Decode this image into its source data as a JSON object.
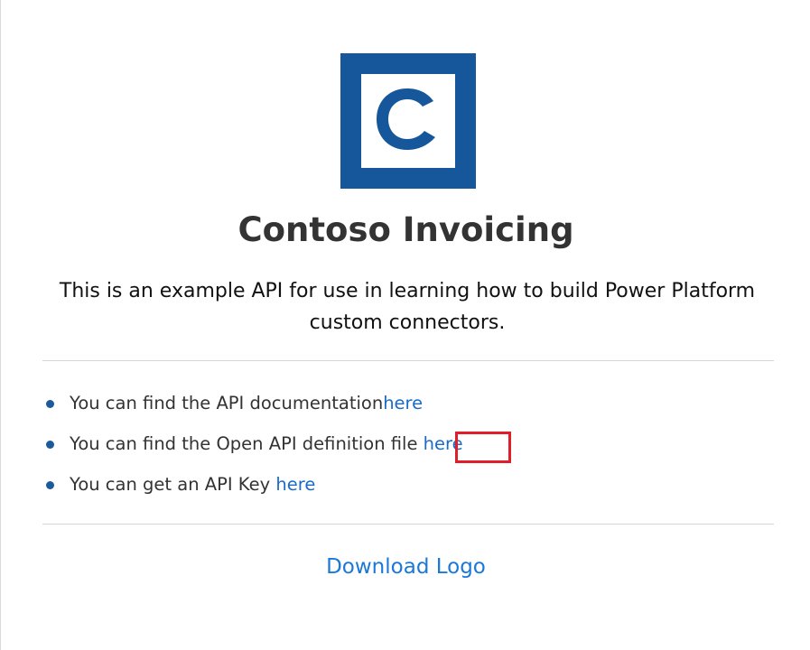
{
  "logo": {
    "letter": "C",
    "color": "#15579a"
  },
  "title": "Contoso Invoicing",
  "subtitle": "This is an example API for use in learning how to build Power Platform custom connectors.",
  "links": [
    {
      "text": "You can find the API documentation",
      "link_label": "here"
    },
    {
      "text": "You can find the Open API definition file ",
      "link_label": "here"
    },
    {
      "text": "You can get an API Key ",
      "link_label": "here"
    }
  ],
  "download_label": "Download Logo",
  "colors": {
    "link": "#1a6bc7",
    "highlight_box": "#e01e2a",
    "bullet": "#1c5a9c"
  }
}
